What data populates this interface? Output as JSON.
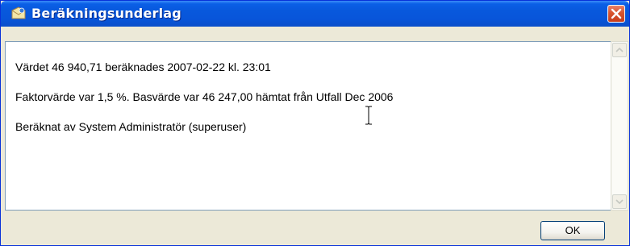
{
  "window": {
    "title": "Beräkningsunderlag",
    "title_icon": "app-envelope-icon",
    "close_icon": "close-icon"
  },
  "content": {
    "lines": [
      "Värdet  46 940,71 beräknades 2007-02-22 kl. 23:01",
      "Faktorvärde var 1,5 %. Basvärde var  46 247,00 hämtat från Utfall Dec 2006",
      "Beräknat av System Administratör (superuser)"
    ]
  },
  "buttons": {
    "ok_label": "OK"
  },
  "colors": {
    "titlebar": "#0858dc",
    "close_button": "#d8552f",
    "dialog_face": "#ece9d8",
    "content_background": "#ffffff"
  }
}
